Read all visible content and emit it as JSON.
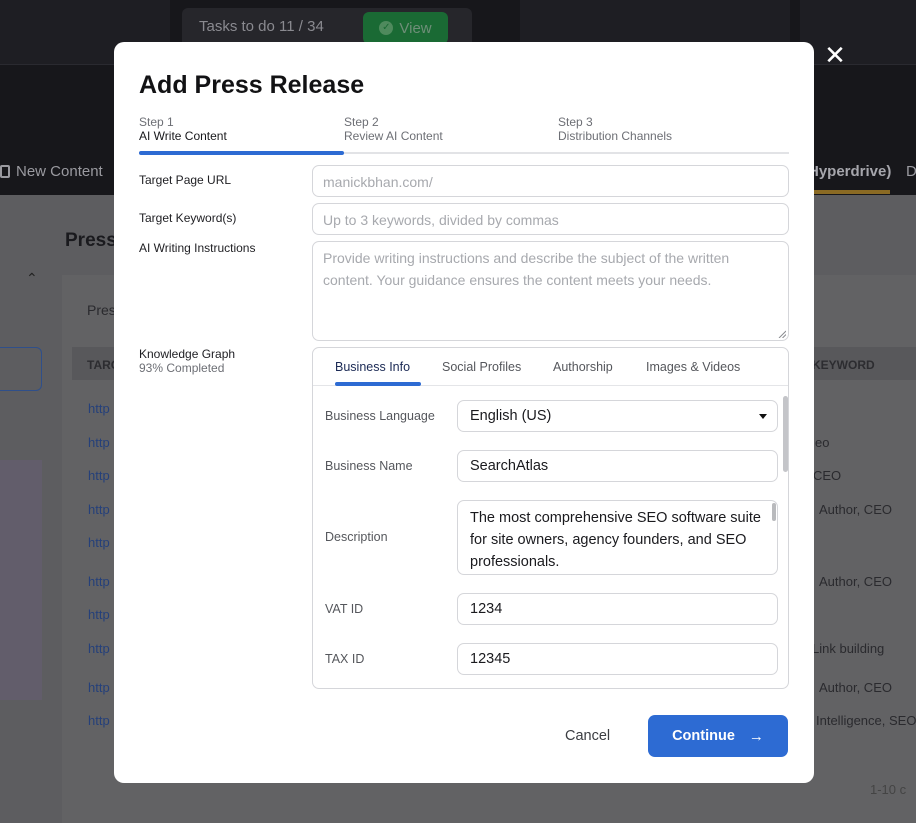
{
  "background": {
    "tasks": "Tasks to do 11 / 34",
    "view_label": "View",
    "nav_new_content": "New Content",
    "nav_hyperdrive": "Hyperdrive)",
    "nav_trailing": "D",
    "page_title": "Press",
    "card_title": "Pres",
    "table_header_left": "TARG",
    "table_header_right": "KEYWORD",
    "link_text": "http",
    "keywords": [
      "eo",
      "CEO",
      "Author, CEO",
      "Author, CEO",
      "Link building",
      "Author, CEO",
      "Intelligence, SEO"
    ],
    "pager": "1-10 c"
  },
  "modal": {
    "title": "Add Press Release",
    "close_icon": "close-icon",
    "steps": [
      {
        "num": "Step 1",
        "name": "AI Write Content",
        "active": true
      },
      {
        "num": "Step 2",
        "name": "Review AI Content",
        "active": false
      },
      {
        "num": "Step 3",
        "name": "Distribution Channels",
        "active": false
      }
    ],
    "target_url": {
      "label": "Target Page URL",
      "placeholder": "manickbhan.com/"
    },
    "target_keywords": {
      "label": "Target Keyword(s)",
      "placeholder": "Up to 3 keywords, divided by commas"
    },
    "instructions": {
      "label": "AI Writing Instructions",
      "placeholder": "Provide writing instructions and describe the subject of the written content. Your guidance ensures the content meets your needs."
    },
    "knowledge_graph": {
      "label": "Knowledge Graph",
      "completion": "93% Completed",
      "tabs": [
        "Business Info",
        "Social Profiles",
        "Authorship",
        "Images & Videos"
      ],
      "active_tab": "Business Info",
      "fields": {
        "language": {
          "label": "Business Language",
          "value": "English (US)"
        },
        "name": {
          "label": "Business Name",
          "value": "SearchAtlas"
        },
        "description": {
          "label": "Description",
          "value": "The most comprehensive SEO software suite for site owners, agency founders, and SEO professionals."
        },
        "vat": {
          "label": "VAT ID",
          "value": "1234"
        },
        "tax": {
          "label": "TAX ID",
          "value": "12345"
        }
      }
    },
    "cancel_label": "Cancel",
    "continue_label": "Continue",
    "continue_icon": "arrow-right-icon",
    "accent_color": "#2d6bd3"
  }
}
